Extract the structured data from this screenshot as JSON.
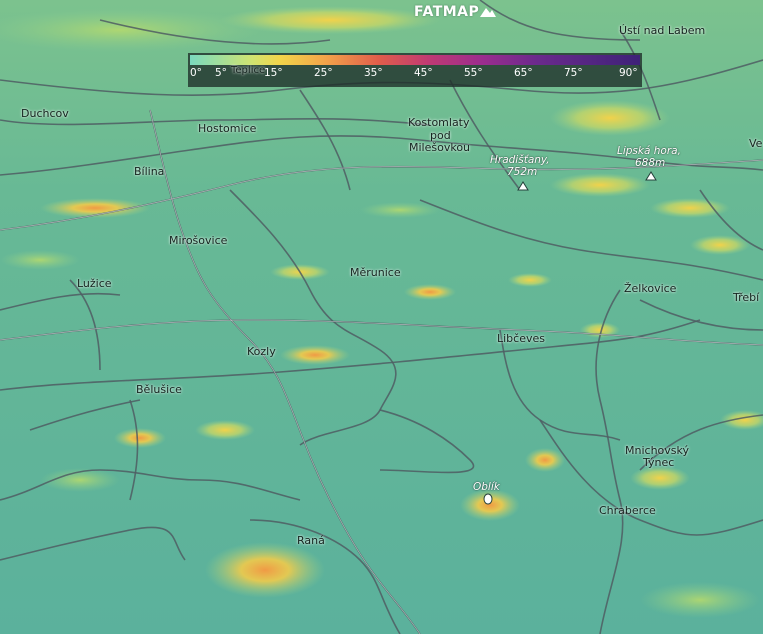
{
  "app": {
    "logo_text": "FATMAP"
  },
  "legend": {
    "overlay_label": "Teplice",
    "ticks": [
      "0°",
      "5°",
      "15°",
      "25°",
      "35°",
      "45°",
      "55°",
      "65°",
      "75°",
      "90°"
    ]
  },
  "places": {
    "usti_nad_labem": "Ústí nad Labem",
    "duchcov": "Duchcov",
    "hostomice": "Hostomice",
    "kostomlaty_1": "Kostomlaty",
    "kostomlaty_2": "pod",
    "kostomlaty_3": "Milešovkou",
    "bilina": "Bílina",
    "mirosovice": "Mirošovice",
    "merunice": "Měrunice",
    "luzice": "Lužice",
    "zelkovice": "Želkovice",
    "trebi": "Třebí",
    "ve": "Ve",
    "libceves": "Libčeves",
    "kozly": "Kozly",
    "belusice": "Bělušice",
    "mnichovsky_1": "Mnichovský",
    "mnichovsky_2": "Týnec",
    "chraberce": "Chraberce",
    "rana": "Raná"
  },
  "peaks": {
    "hradistany_name": "Hradišťany,",
    "hradistany_elev": "752m",
    "lipska_name": "Lipská hora,",
    "lipska_elev": "688m",
    "oblik_name": "Oblík"
  }
}
